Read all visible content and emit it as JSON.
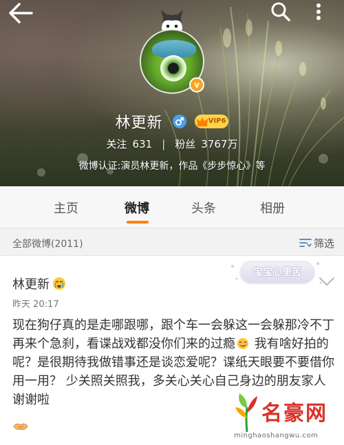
{
  "header": {
    "profile_name": "林更新",
    "vip_label": "VIP6",
    "verified_symbol": "v",
    "following_label": "关注",
    "following_count": "631",
    "stat_separator": "|",
    "followers_label": "粉丝",
    "followers_count": "3767万",
    "verification": "微博认证:演员林更新，作品《步步惊心》等",
    "icons": [
      "back-arrow-icon",
      "search-icon",
      "more-icon",
      "gender-male-icon",
      "vip-crown-icon",
      "verified-badge"
    ]
  },
  "tabs": [
    {
      "label": "主页",
      "active": false
    },
    {
      "label": "微博",
      "active": true
    },
    {
      "label": "头条",
      "active": false
    },
    {
      "label": "相册",
      "active": false
    }
  ],
  "filter": {
    "title": "全部微博(2011)",
    "button_label": "筛选"
  },
  "post": {
    "author": "林更新",
    "time": "昨天 20:17",
    "sticker": "宝宝心里苦",
    "text_part1": "现在狗仔真的是走哪跟哪，跟个车一会躲这一会躲那冷不丁再来个急刹，看谍战戏都没你们来的过瘾",
    "text_part2": " 我有啥好拍的呢？是很期待我做错事还是谈恋爱呢？谍纸天眼要不要借你用一用？ 少关照关照我，多关心关心自己身边的朋友家人  谢谢啦",
    "accent_color": "#ff8200"
  },
  "watermark": {
    "title": "名豪网",
    "url": "minghaoshangwu.com"
  }
}
